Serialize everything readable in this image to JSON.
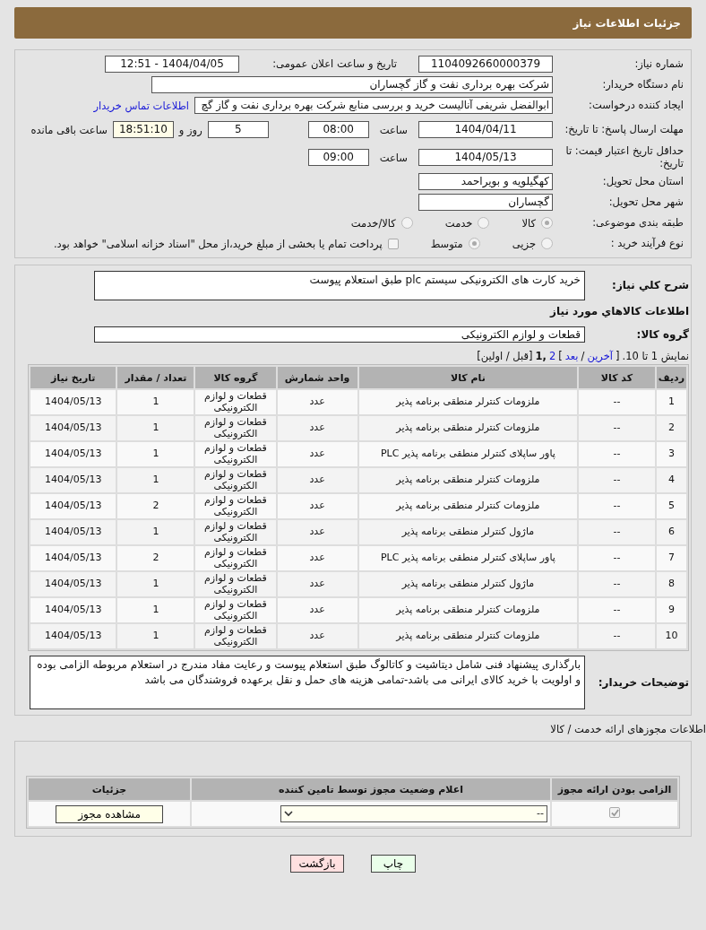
{
  "header": {
    "title": "جزئیات اطلاعات نیاز"
  },
  "need_info": {
    "need_number": {
      "label": "شماره نیاز:",
      "value": "1104092660000379"
    },
    "announce": {
      "label": "تاریخ و ساعت اعلان عمومی:",
      "value": "1404/04/05 - 12:51"
    },
    "buyer_org": {
      "label": "نام دستگاه خریدار:",
      "value": "شرکت بهره برداری نفت و گاز گچساران"
    },
    "requester": {
      "label": "ایجاد کننده درخواست:",
      "value": "ابوالفضل شریفی آنالیست خرید و بررسی منابع شرکت بهره برداری نفت و گاز گچ",
      "link": "اطلاعات تماس خریدار"
    },
    "reply_deadline": {
      "label": "مهلت ارسال پاسخ: تا تاریخ:",
      "date": "1404/04/11",
      "time_label": "ساعت",
      "time": "08:00",
      "days": "5",
      "days_label": "روز و",
      "remaining": "18:51:10",
      "remaining_label": "ساعت باقی مانده"
    },
    "price_validity": {
      "label": "حداقل تاریخ اعتبار قیمت: تا تاریخ:",
      "date": "1404/05/13",
      "time_label": "ساعت",
      "time": "09:00"
    },
    "province": {
      "label": "استان محل تحویل:",
      "value": "کهگیلویه و بویراحمد"
    },
    "city": {
      "label": "شهر محل تحویل:",
      "value": "گچساران"
    },
    "category": {
      "label": "طبقه بندی موضوعی:",
      "options": [
        {
          "label": "کالا",
          "selected": true
        },
        {
          "label": "خدمت",
          "selected": false
        },
        {
          "label": "کالا/خدمت",
          "selected": false
        }
      ]
    },
    "process": {
      "label": "نوع فرآیند خرید :",
      "options": [
        {
          "label": "جزیی",
          "selected": false
        },
        {
          "label": "متوسط",
          "selected": true
        }
      ],
      "payment_note": {
        "label": "پرداخت تمام یا بخشی از مبلغ خرید،از محل \"اسناد خزانه اسلامی\" خواهد بود.",
        "checked": false
      }
    }
  },
  "goods": {
    "description": {
      "label": "شرح كلي نياز:",
      "value": "خرید کارت های الکترونیکی سیستم plc طبق استعلام پیوست"
    },
    "section_title": "اطلاعات كالاهاي مورد نياز",
    "group": {
      "label": "گروه کالا:",
      "value": "قطعات و لوازم الکترونیکی"
    },
    "pagination": [
      {
        "kind": "plain",
        "text": "نمایش 1 تا 10."
      },
      {
        "kind": "plain",
        "text": "["
      },
      {
        "kind": "link",
        "text": "آخرین"
      },
      {
        "kind": "plain",
        "text": "/"
      },
      {
        "kind": "link",
        "text": "بعد"
      },
      {
        "kind": "plain",
        "text": "]"
      },
      {
        "kind": "link",
        "text": "2"
      },
      {
        "kind": "current",
        "text": ",1"
      },
      {
        "kind": "plain",
        "text": "[قبل / اولین]"
      }
    ],
    "table": {
      "columns": [
        "ردیف",
        "کد کالا",
        "نام کالا",
        "واحد شمارش",
        "گروه کالا",
        "تعداد / مقدار",
        "تاریخ نیاز"
      ],
      "rows": [
        [
          "1",
          "--",
          "ملزومات کنترلر منطقی برنامه پذیر",
          "عدد",
          "قطعات و لوازم الکترونیکی",
          "1",
          "1404/05/13"
        ],
        [
          "2",
          "--",
          "ملزومات کنترلر منطقی برنامه پذیر",
          "عدد",
          "قطعات و لوازم الکترونیکی",
          "1",
          "1404/05/13"
        ],
        [
          "3",
          "--",
          "پاور ساپلای کنترلر منطقی برنامه پذیر PLC",
          "عدد",
          "قطعات و لوازم الکترونیکی",
          "1",
          "1404/05/13"
        ],
        [
          "4",
          "--",
          "ملزومات کنترلر منطقی برنامه پذیر",
          "عدد",
          "قطعات و لوازم الکترونیکی",
          "1",
          "1404/05/13"
        ],
        [
          "5",
          "--",
          "ملزومات کنترلر منطقی برنامه پذیر",
          "عدد",
          "قطعات و لوازم الکترونیکی",
          "2",
          "1404/05/13"
        ],
        [
          "6",
          "--",
          "ماژول کنترلر منطقی برنامه پذیر",
          "عدد",
          "قطعات و لوازم الکترونیکی",
          "1",
          "1404/05/13"
        ],
        [
          "7",
          "--",
          "پاور ساپلای کنترلر منطقی برنامه پذیر PLC",
          "عدد",
          "قطعات و لوازم الکترونیکی",
          "2",
          "1404/05/13"
        ],
        [
          "8",
          "--",
          "ماژول کنترلر منطقی برنامه پذیر",
          "عدد",
          "قطعات و لوازم الکترونیکی",
          "1",
          "1404/05/13"
        ],
        [
          "9",
          "--",
          "ملزومات کنترلر منطقی برنامه پذیر",
          "عدد",
          "قطعات و لوازم الکترونیکی",
          "1",
          "1404/05/13"
        ],
        [
          "10",
          "--",
          "ملزومات کنترلر منطقی برنامه پذیر",
          "عدد",
          "قطعات و لوازم الکترونیکی",
          "1",
          "1404/05/13"
        ]
      ]
    },
    "buyer_notes": {
      "label": "توضیحات خریدار:",
      "value": "بارگذاری پیشنهاد فنی شامل دیتاشیت و کاتالوگ طبق استعلام پیوست و رعایت مفاد مندرج در استعلام مربوطه الزامی بوده و اولویت با خرید کالای ایرانی می باشد-تمامی هزینه های حمل و نقل برعهده فروشندگان می باشد"
    }
  },
  "permits": {
    "title": "اطلاعات مجوزهای ارائه خدمت / کالا",
    "columns": [
      "الزامی بودن ارائه مجوز",
      "اعلام وضعیت مجوز توسط تامین کننده",
      "جزئیات"
    ],
    "row": {
      "required": true,
      "status": "--",
      "details_button": "مشاهده مجوز"
    }
  },
  "buttons": [
    {
      "label": "چاپ",
      "kind": "print"
    },
    {
      "label": "بازگشت",
      "kind": "back"
    }
  ]
}
